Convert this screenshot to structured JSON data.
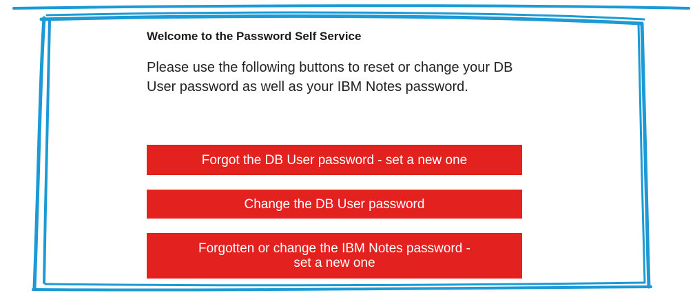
{
  "panel": {
    "title": "Welcome to the Password Self Service",
    "description": "Please use the following buttons to reset or change your DB User password as well as your IBM Notes password."
  },
  "buttons": {
    "forgot_db": "Forgot the DB User password - set a new one",
    "change_db": "Change the DB User password",
    "notes_line1": "Forgotten or change the IBM Notes password -",
    "notes_line2": "set a new one"
  },
  "colors": {
    "button_bg": "#e3221f",
    "frame": "#1b9ad6"
  }
}
